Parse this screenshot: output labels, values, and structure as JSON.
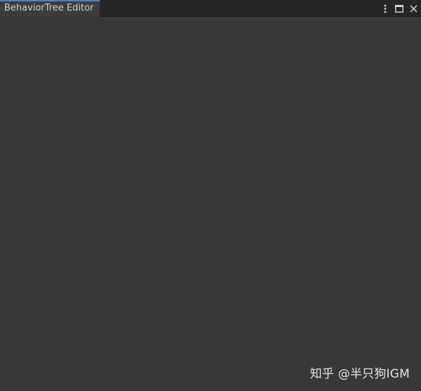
{
  "window": {
    "tab_title": "BehaviorTree Editor"
  },
  "controls": {
    "menu_icon": "more-vertical-icon",
    "maximize_icon": "maximize-icon",
    "close_icon": "close-icon"
  },
  "watermark": {
    "text": "知乎 @半只狗IGM"
  },
  "colors": {
    "background": "#383838",
    "tabbar": "#262626",
    "active_tab": "#3c3c3c",
    "tab_accent": "#4a84c4"
  }
}
